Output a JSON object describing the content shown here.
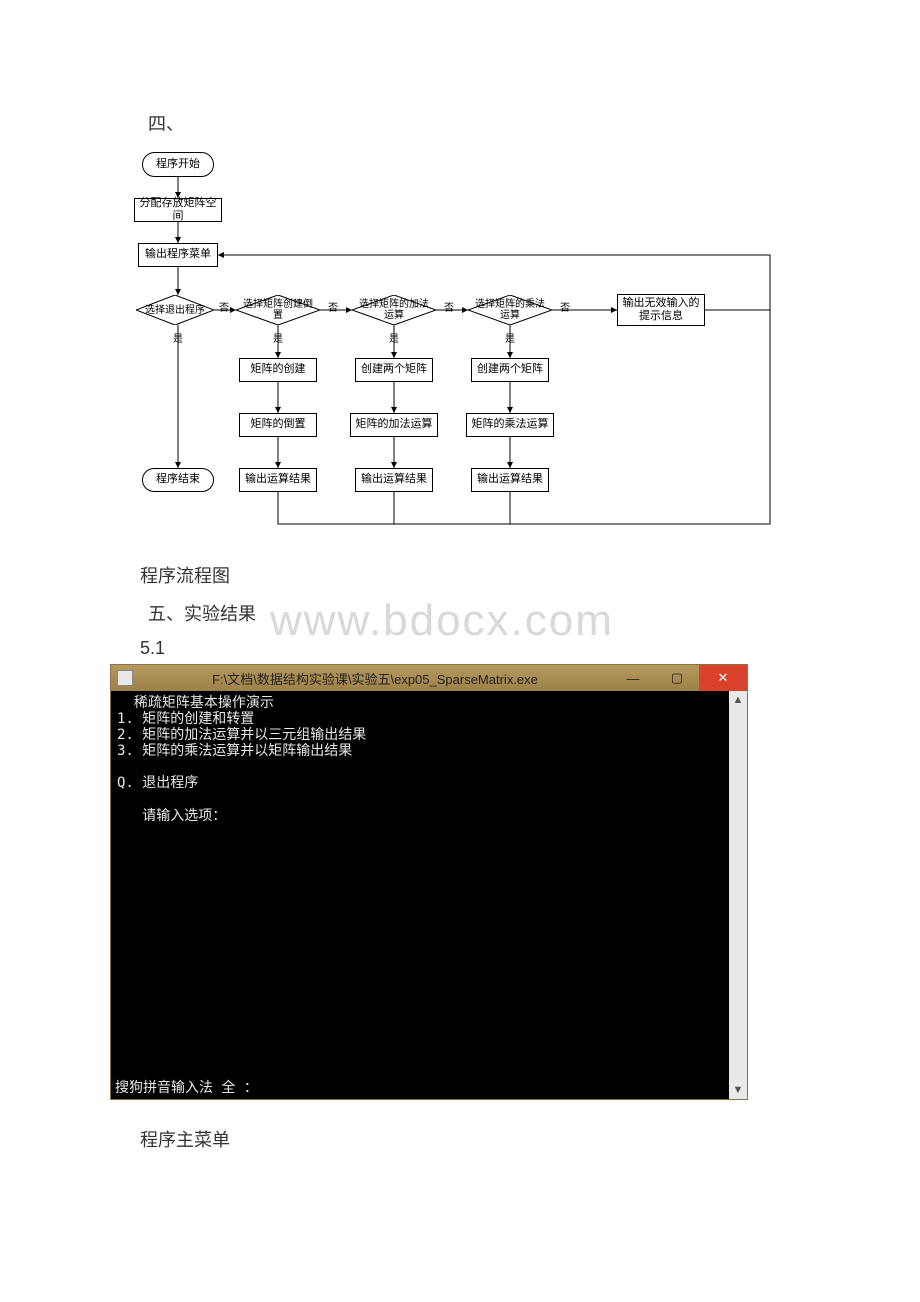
{
  "headings": {
    "section4": "四、",
    "flowchart_caption": "程序流程图",
    "section5": "五、实验结果",
    "section5_1": "5.1",
    "main_menu_caption": "程序主菜单"
  },
  "watermark": "www.bdocx.com",
  "flowchart": {
    "start": "程序开始",
    "alloc": "分配存放矩阵空间",
    "menu": "输出程序菜单",
    "d_exit": "选择退出程序",
    "d_create": "选择矩阵创建倒置",
    "d_add": "选择矩阵的加法运算",
    "d_mul": "选择矩阵的乘法运算",
    "invalid_hint": "输出无效输入的提示信息",
    "create": "矩阵的创建",
    "transpose": "矩阵的倒置",
    "create_two_a": "创建两个矩阵",
    "create_two_b": "创建两个矩阵",
    "add_op": "矩阵的加法运算",
    "mul_op": "矩阵的乘法运算",
    "out1": "输出运算结果",
    "out2": "输出运算结果",
    "out3": "输出运算结果",
    "end": "程序结束",
    "yes": "是",
    "no": "否"
  },
  "console": {
    "title": "F:\\文档\\数据结构实验课\\实验五\\exp05_SparseMatrix.exe",
    "lines": {
      "header": "  稀疏矩阵基本操作演示",
      "opt1": "1. 矩阵的创建和转置",
      "opt2": "2. 矩阵的加法运算并以三元组输出结果",
      "opt3": "3. 矩阵的乘法运算并以矩阵输出结果",
      "quit": "Q. 退出程序",
      "prompt": "   请输入选项："
    },
    "ime": "搜狗拼音输入法 全 ："
  },
  "win_buttons": {
    "min": "—",
    "max": "▢",
    "close": "✕"
  },
  "scroll": {
    "up": "▲",
    "down": "▼"
  }
}
